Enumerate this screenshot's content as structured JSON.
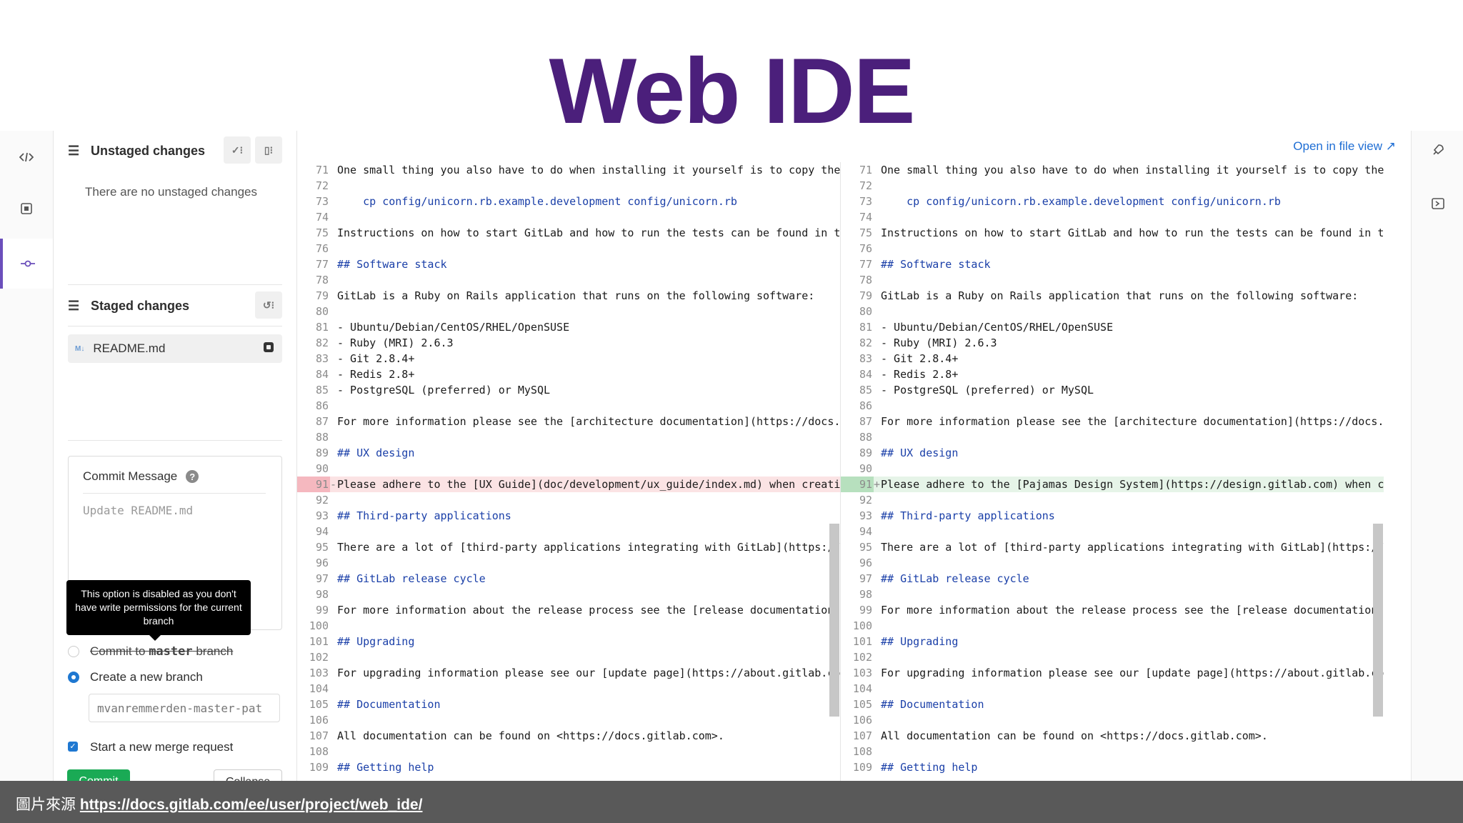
{
  "slide": {
    "title": "Web IDE"
  },
  "activity_bar": {
    "items": [
      "edit-icon",
      "review-icon",
      "commit-icon"
    ],
    "active": "commit-icon"
  },
  "commit_panel": {
    "unstaged": {
      "title": "Unstaged changes",
      "empty_text": "There are no unstaged changes"
    },
    "staged": {
      "title": "Staged changes",
      "files": [
        {
          "badge": "M↓",
          "name": "README.md"
        }
      ]
    },
    "commit_message": {
      "label": "Commit Message",
      "help": "?",
      "placeholder": "Update README.md"
    },
    "tooltip": "This option is disabled as you don't have write permissions for the current branch",
    "options": {
      "commit_to_branch_prefix": "Commit to ",
      "commit_to_branch_name": "master",
      "commit_to_branch_suffix": " branch",
      "new_branch": "Create a new branch",
      "branch_name": "mvanremmerden-master-pat",
      "merge_request": "Start a new merge request"
    },
    "buttons": {
      "commit": "Commit",
      "collapse": "Collapse"
    }
  },
  "editor": {
    "open_in_file_view": "Open in file view ↗",
    "left_lines": [
      {
        "n": "71",
        "m": "",
        "t": "One small thing you also have to do when installing it yourself is to copy the e",
        "s": ""
      },
      {
        "n": "72",
        "m": "",
        "t": "",
        "s": ""
      },
      {
        "n": "73",
        "m": "",
        "t": "    cp config/unicorn.rb.example.development config/unicorn.rb",
        "s": "cmd"
      },
      {
        "n": "74",
        "m": "",
        "t": "",
        "s": ""
      },
      {
        "n": "75",
        "m": "",
        "t": "Instructions on how to start GitLab and how to run the tests can be found in the",
        "s": ""
      },
      {
        "n": "76",
        "m": "",
        "t": "",
        "s": ""
      },
      {
        "n": "77",
        "m": "",
        "t": "## Software stack",
        "s": "hd"
      },
      {
        "n": "78",
        "m": "",
        "t": "",
        "s": ""
      },
      {
        "n": "79",
        "m": "",
        "t": "GitLab is a Ruby on Rails application that runs on the following software:",
        "s": ""
      },
      {
        "n": "80",
        "m": "",
        "t": "",
        "s": ""
      },
      {
        "n": "81",
        "m": "",
        "t": "- Ubuntu/Debian/CentOS/RHEL/OpenSUSE",
        "s": ""
      },
      {
        "n": "82",
        "m": "",
        "t": "- Ruby (MRI) 2.6.3",
        "s": ""
      },
      {
        "n": "83",
        "m": "",
        "t": "- Git 2.8.4+",
        "s": ""
      },
      {
        "n": "84",
        "m": "",
        "t": "- Redis 2.8+",
        "s": ""
      },
      {
        "n": "85",
        "m": "",
        "t": "- PostgreSQL (preferred) or MySQL",
        "s": ""
      },
      {
        "n": "86",
        "m": "",
        "t": "",
        "s": ""
      },
      {
        "n": "87",
        "m": "",
        "t": "For more information please see the [architecture documentation](https://docs.gi",
        "s": ""
      },
      {
        "n": "88",
        "m": "",
        "t": "",
        "s": ""
      },
      {
        "n": "89",
        "m": "",
        "t": "## UX design",
        "s": "hd"
      },
      {
        "n": "90",
        "m": "",
        "t": "",
        "s": ""
      },
      {
        "n": "91",
        "m": "-",
        "t": "Please adhere to the [UX Guide](doc/development/ux_guide/index.md) when creating",
        "s": "del"
      },
      {
        "n": "92",
        "m": "",
        "t": "",
        "s": ""
      },
      {
        "n": "93",
        "m": "",
        "t": "## Third-party applications",
        "s": "hd"
      },
      {
        "n": "94",
        "m": "",
        "t": "",
        "s": ""
      },
      {
        "n": "95",
        "m": "",
        "t": "There are a lot of [third-party applications integrating with GitLab](https://ab",
        "s": ""
      },
      {
        "n": "96",
        "m": "",
        "t": "",
        "s": ""
      },
      {
        "n": "97",
        "m": "",
        "t": "## GitLab release cycle",
        "s": "hd"
      },
      {
        "n": "98",
        "m": "",
        "t": "",
        "s": ""
      },
      {
        "n": "99",
        "m": "",
        "t": "For more information about the release process see the [release documentation](h",
        "s": ""
      },
      {
        "n": "100",
        "m": "",
        "t": "",
        "s": ""
      },
      {
        "n": "101",
        "m": "",
        "t": "## Upgrading",
        "s": "hd"
      },
      {
        "n": "102",
        "m": "",
        "t": "",
        "s": ""
      },
      {
        "n": "103",
        "m": "",
        "t": "For upgrading information please see our [update page](https://about.gitlab.com/",
        "s": ""
      },
      {
        "n": "104",
        "m": "",
        "t": "",
        "s": ""
      },
      {
        "n": "105",
        "m": "",
        "t": "## Documentation",
        "s": "hd"
      },
      {
        "n": "106",
        "m": "",
        "t": "",
        "s": ""
      },
      {
        "n": "107",
        "m": "",
        "t": "All documentation can be found on <https://docs.gitlab.com>.",
        "s": ""
      },
      {
        "n": "108",
        "m": "",
        "t": "",
        "s": ""
      },
      {
        "n": "109",
        "m": "",
        "t": "## Getting help",
        "s": "hd"
      }
    ],
    "right_lines": [
      {
        "n": "71",
        "m": "",
        "t": "One small thing you also have to do when installing it yourself is to copy the e:",
        "s": ""
      },
      {
        "n": "72",
        "m": "",
        "t": "",
        "s": ""
      },
      {
        "n": "73",
        "m": "",
        "t": "    cp config/unicorn.rb.example.development config/unicorn.rb",
        "s": "cmd"
      },
      {
        "n": "74",
        "m": "",
        "t": "",
        "s": ""
      },
      {
        "n": "75",
        "m": "",
        "t": "Instructions on how to start GitLab and how to run the tests can be found in the",
        "s": ""
      },
      {
        "n": "76",
        "m": "",
        "t": "",
        "s": ""
      },
      {
        "n": "77",
        "m": "",
        "t": "## Software stack",
        "s": "hd"
      },
      {
        "n": "78",
        "m": "",
        "t": "",
        "s": ""
      },
      {
        "n": "79",
        "m": "",
        "t": "GitLab is a Ruby on Rails application that runs on the following software:",
        "s": ""
      },
      {
        "n": "80",
        "m": "",
        "t": "",
        "s": ""
      },
      {
        "n": "81",
        "m": "",
        "t": "- Ubuntu/Debian/CentOS/RHEL/OpenSUSE",
        "s": ""
      },
      {
        "n": "82",
        "m": "",
        "t": "- Ruby (MRI) 2.6.3",
        "s": ""
      },
      {
        "n": "83",
        "m": "",
        "t": "- Git 2.8.4+",
        "s": ""
      },
      {
        "n": "84",
        "m": "",
        "t": "- Redis 2.8+",
        "s": ""
      },
      {
        "n": "85",
        "m": "",
        "t": "- PostgreSQL (preferred) or MySQL",
        "s": ""
      },
      {
        "n": "86",
        "m": "",
        "t": "",
        "s": ""
      },
      {
        "n": "87",
        "m": "",
        "t": "For more information please see the [architecture documentation](https://docs.gi",
        "s": ""
      },
      {
        "n": "88",
        "m": "",
        "t": "",
        "s": ""
      },
      {
        "n": "89",
        "m": "",
        "t": "## UX design",
        "s": "hd"
      },
      {
        "n": "90",
        "m": "",
        "t": "",
        "s": ""
      },
      {
        "n": "91",
        "m": "+",
        "t": "Please adhere to the [Pajamas Design System](https://design.gitlab.com) when crea",
        "s": "add"
      },
      {
        "n": "92",
        "m": "",
        "t": "",
        "s": ""
      },
      {
        "n": "93",
        "m": "",
        "t": "## Third-party applications",
        "s": "hd"
      },
      {
        "n": "94",
        "m": "",
        "t": "",
        "s": ""
      },
      {
        "n": "95",
        "m": "",
        "t": "There are a lot of [third-party applications integrating with GitLab](https://ab",
        "s": ""
      },
      {
        "n": "96",
        "m": "",
        "t": "",
        "s": ""
      },
      {
        "n": "97",
        "m": "",
        "t": "## GitLab release cycle",
        "s": "hd"
      },
      {
        "n": "98",
        "m": "",
        "t": "",
        "s": ""
      },
      {
        "n": "99",
        "m": "",
        "t": "For more information about the release process see the [release documentation](h",
        "s": ""
      },
      {
        "n": "100",
        "m": "",
        "t": "",
        "s": ""
      },
      {
        "n": "101",
        "m": "",
        "t": "## Upgrading",
        "s": "hd"
      },
      {
        "n": "102",
        "m": "",
        "t": "",
        "s": ""
      },
      {
        "n": "103",
        "m": "",
        "t": "For upgrading information please see our [update page](https://about.gitlab.com/",
        "s": ""
      },
      {
        "n": "104",
        "m": "",
        "t": "",
        "s": ""
      },
      {
        "n": "105",
        "m": "",
        "t": "## Documentation",
        "s": "hd"
      },
      {
        "n": "106",
        "m": "",
        "t": "",
        "s": ""
      },
      {
        "n": "107",
        "m": "",
        "t": "All documentation can be found on <https://docs.gitlab.com>.",
        "s": ""
      },
      {
        "n": "108",
        "m": "",
        "t": "",
        "s": ""
      },
      {
        "n": "109",
        "m": "",
        "t": "## Getting help",
        "s": "hd"
      }
    ]
  },
  "right_bar": {
    "items": [
      "pipeline-rocket-icon",
      "terminal-icon"
    ]
  },
  "caption": {
    "label": "圖片來源 ",
    "url": "https://docs.gitlab.com/ee/user/project/web_ide/"
  },
  "colors": {
    "title": "#4b1f7b",
    "accent": "#6b4fbb",
    "link": "#1f6ed4",
    "commit_green": "#1aaa55",
    "deleted": "#fbe3e4",
    "added": "#e6f4e8"
  }
}
